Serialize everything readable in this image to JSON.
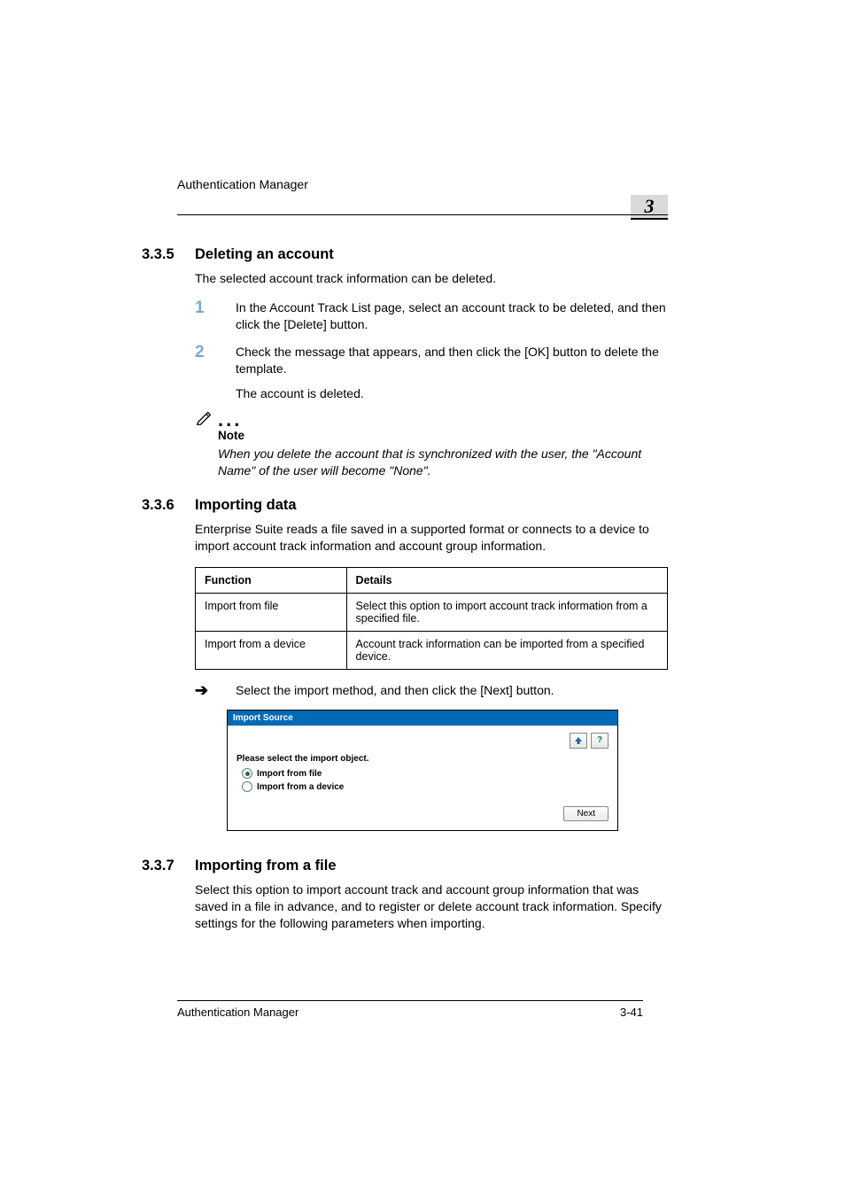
{
  "header": {
    "running": "Authentication Manager",
    "chapter": "3"
  },
  "sec335": {
    "num": "3.3.5",
    "title": "Deleting an account",
    "intro": "The selected account track information can be deleted.",
    "step1_num": "1",
    "step1": "In the Account Track List page, select an account track to be deleted, and then click the [Delete] button.",
    "step2_num": "2",
    "step2": "Check the message that appears, and then click the [OK] button to delete the template.",
    "step2_result": "The account is deleted.",
    "note_label": "Note",
    "note_body": "When you delete the account that is synchronized with the user, the \"Account Name\" of the user will become \"None\"."
  },
  "sec336": {
    "num": "3.3.6",
    "title": "Importing data",
    "intro": "Enterprise Suite reads a file saved in a supported format or connects to a device to import account track information and account group information.",
    "table": {
      "h1": "Function",
      "h2": "Details",
      "r1c1": "Import from file",
      "r1c2": "Select this option to import account track information from a specified file.",
      "r2c1": "Import from a device",
      "r2c2": "Account track information can be imported from a specified device."
    },
    "arrow_text": "Select the import method, and then click the [Next] button.",
    "screenshot": {
      "title": "Import Source",
      "prompt": "Please select the import object.",
      "opt1": "Import from file",
      "opt2": "Import from a device",
      "next": "Next",
      "help_glyph": "?"
    }
  },
  "sec337": {
    "num": "3.3.7",
    "title": "Importing from a file",
    "body": "Select this option to import account track and account group information that was saved in a file in advance, and to register or delete account track information. Specify settings for the following parameters when importing."
  },
  "footer": {
    "left": "Authentication Manager",
    "right": "3-41"
  }
}
